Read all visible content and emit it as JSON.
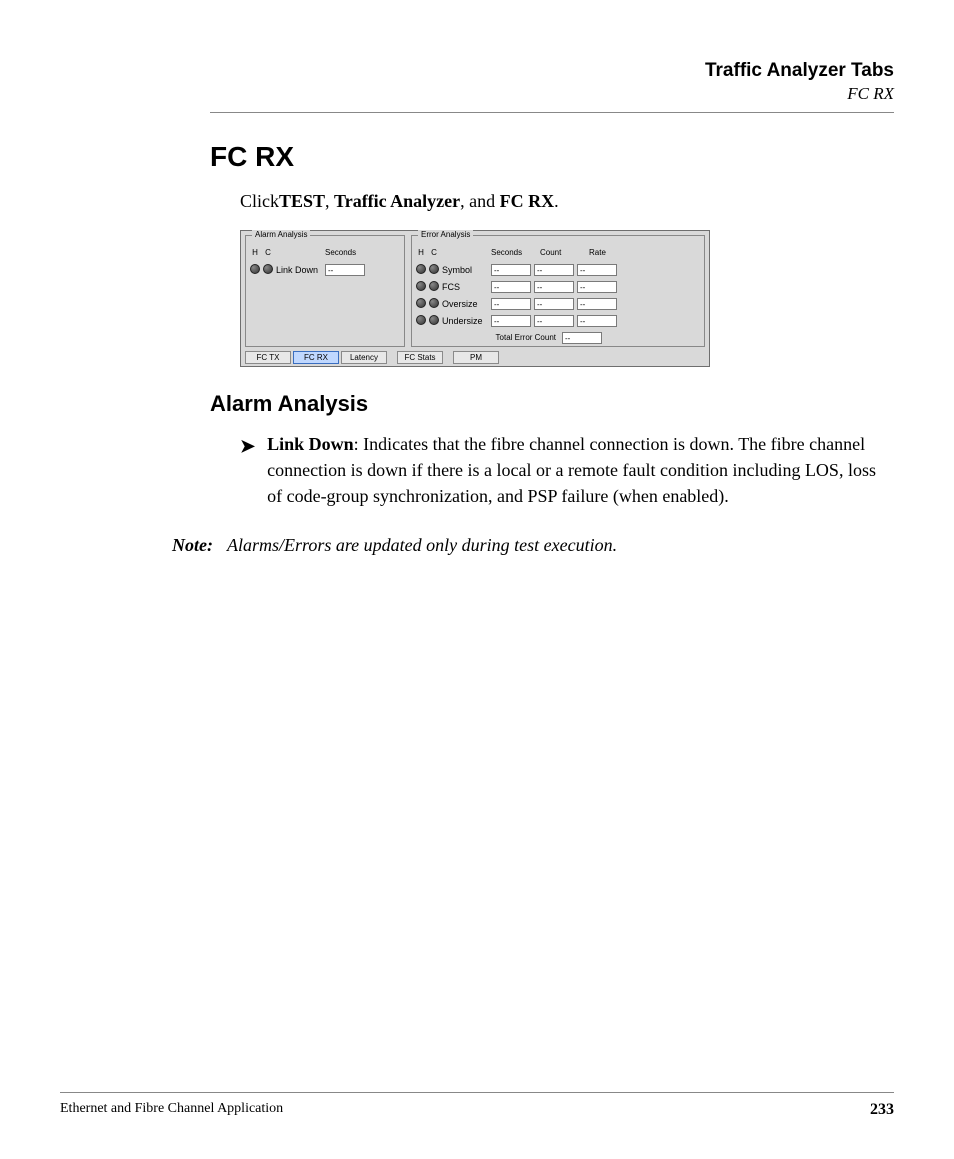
{
  "header": {
    "title": "Traffic Analyzer Tabs",
    "subtitle": "FC RX"
  },
  "section_title": "FC RX",
  "intro": {
    "pre": "Click",
    "b1": "TEST",
    "sep1": ", ",
    "b2": "Traffic Analyzer",
    "sep2": ", and ",
    "b3": "FC RX",
    "post": "."
  },
  "screenshot": {
    "alarm": {
      "legend": "Alarm Analysis",
      "head_h": "H",
      "head_c": "C",
      "head_seconds": "Seconds",
      "rows": [
        {
          "label": "Link Down",
          "seconds": "--"
        }
      ]
    },
    "error": {
      "legend": "Error Analysis",
      "head_h": "H",
      "head_c": "C",
      "head_seconds": "Seconds",
      "head_count": "Count",
      "head_rate": "Rate",
      "rows": [
        {
          "label": "Symbol",
          "seconds": "--",
          "count": "--",
          "rate": "--"
        },
        {
          "label": "FCS",
          "seconds": "--",
          "count": "--",
          "rate": "--"
        },
        {
          "label": "Oversize",
          "seconds": "--",
          "count": "--",
          "rate": "--"
        },
        {
          "label": "Undersize",
          "seconds": "--",
          "count": "--",
          "rate": "--"
        }
      ],
      "total_label": "Total Error Count",
      "total_value": "--"
    },
    "tabs": {
      "items": [
        "FC TX",
        "FC RX",
        "Latency",
        "FC Stats",
        "PM"
      ],
      "active": "FC RX"
    }
  },
  "subsection_title": "Alarm Analysis",
  "bullet": {
    "lead": "Link Down",
    "text": ": Indicates that the fibre channel connection is down. The fibre channel connection is down if there is a local or a remote fault condition including LOS, loss of code-group synchronization, and PSP failure (when enabled)."
  },
  "note": {
    "label": "Note:",
    "text": "Alarms/Errors are updated only during test execution."
  },
  "footer": {
    "left": "Ethernet and Fibre Channel Application",
    "page": "233"
  }
}
